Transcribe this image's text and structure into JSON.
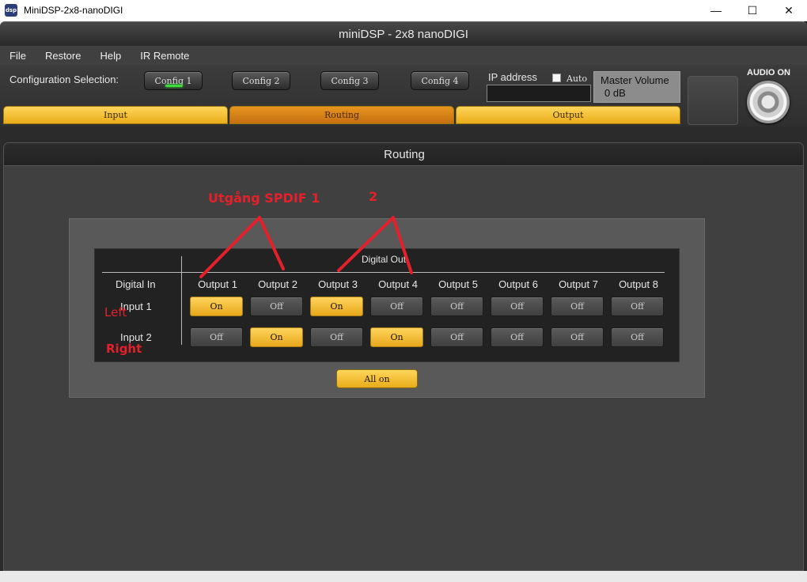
{
  "window": {
    "title": "MiniDSP-2x8-nanoDIGI",
    "icon_text": "dsp",
    "controls": {
      "minimize": "—",
      "maximize": "☐",
      "close": "✕"
    }
  },
  "app": {
    "title": "miniDSP - 2x8 nanoDIGI"
  },
  "menu": [
    "File",
    "Restore",
    "Help",
    "IR Remote"
  ],
  "config": {
    "label": "Configuration Selection:",
    "buttons": [
      "Config 1",
      "Config 2",
      "Config 3",
      "Config 4"
    ],
    "active_index": 0
  },
  "ip": {
    "label": "IP address",
    "auto_label": "Auto",
    "value": "",
    "auto_checked": false
  },
  "master_volume": {
    "label": "Master Volume",
    "value": "0 dB"
  },
  "audio": {
    "label": "AUDIO ON"
  },
  "tabs": [
    {
      "label": "Input",
      "active": false
    },
    {
      "label": "Routing",
      "active": true
    },
    {
      "label": "Output",
      "active": false
    }
  ],
  "panel": {
    "title": "Routing"
  },
  "matrix": {
    "digital_out_label": "Digital Out",
    "digital_in_label": "Digital In",
    "outputs": [
      "Output 1",
      "Output 2",
      "Output 3",
      "Output 4",
      "Output 5",
      "Output 6",
      "Output 7",
      "Output 8"
    ],
    "inputs": [
      "Input 1",
      "Input 2"
    ],
    "on_label": "On",
    "off_label": "Off",
    "state": [
      [
        true,
        false,
        true,
        false,
        false,
        false,
        false,
        false
      ],
      [
        false,
        true,
        false,
        true,
        false,
        false,
        false,
        false
      ]
    ]
  },
  "all_on_label": "All on",
  "annotations": {
    "spdif1": "Utgång SPDIF 1",
    "two": "2",
    "left": "Left",
    "right": "Right",
    "color": "#e4202a"
  },
  "colors": {
    "on": "#f2c039",
    "off": "#4c4c4c",
    "active_tab": "#d8841a"
  }
}
